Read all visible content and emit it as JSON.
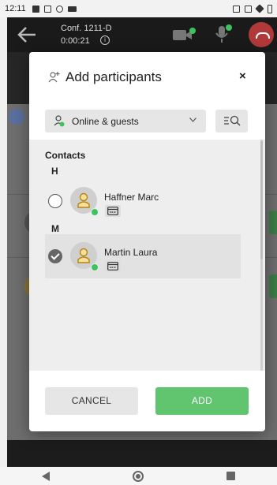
{
  "status_bar": {
    "time": "12:11"
  },
  "call_header": {
    "conference_name": "Conf. 1211-D",
    "duration": "0:00:21"
  },
  "dialog": {
    "title": "Add participants",
    "close_label": "×",
    "filter": {
      "selected": "Online & guests"
    },
    "contacts_heading": "Contacts",
    "groups": [
      {
        "letter": "H",
        "contacts": [
          {
            "name": "Haffner Marc",
            "selected": false,
            "presence": "online"
          }
        ]
      },
      {
        "letter": "M",
        "contacts": [
          {
            "name": "Martin Laura",
            "selected": true,
            "presence": "online"
          }
        ]
      }
    ],
    "cancel_label": "CANCEL",
    "add_label": "ADD"
  },
  "colors": {
    "accent_green": "#61c46f",
    "presence_green": "#3cc35e",
    "hangup_red": "#b03a3a"
  }
}
